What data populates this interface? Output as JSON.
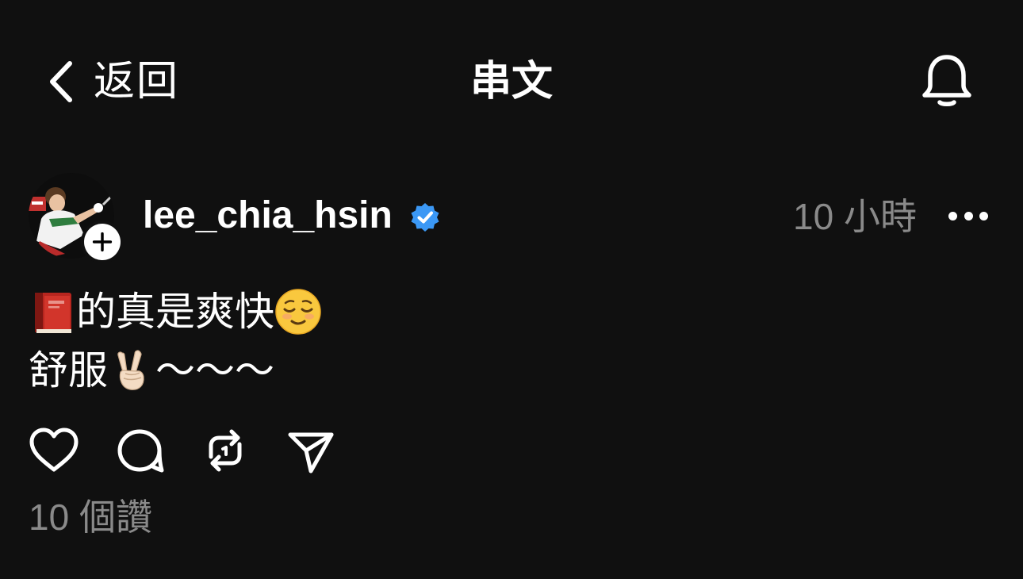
{
  "header": {
    "back_label": "返回",
    "title": "串文",
    "back_icon": "chevron-left-icon",
    "notification_icon": "bell-icon"
  },
  "post": {
    "author": {
      "username": "lee_chia_hsin",
      "verified": true,
      "avatar": "badminton-player-photo"
    },
    "time_ago": "10 小時",
    "content": {
      "line1": {
        "leading_emoji": "red-book-emoji",
        "text": "的真是爽快",
        "trailing_emoji": "relieved-face-emoji"
      },
      "line2": {
        "text": "舒服",
        "emoji": "victory-hand-emoji",
        "trailing_text": "～～～"
      }
    },
    "actions": [
      "heart-icon",
      "comment-icon",
      "repost-icon",
      "share-icon"
    ],
    "likes_text": "10 個讚"
  },
  "colors": {
    "background": "#101010",
    "primary_text": "#ffffff",
    "secondary_text": "#8a8a8a",
    "verified_blue": "#3b98f5"
  }
}
